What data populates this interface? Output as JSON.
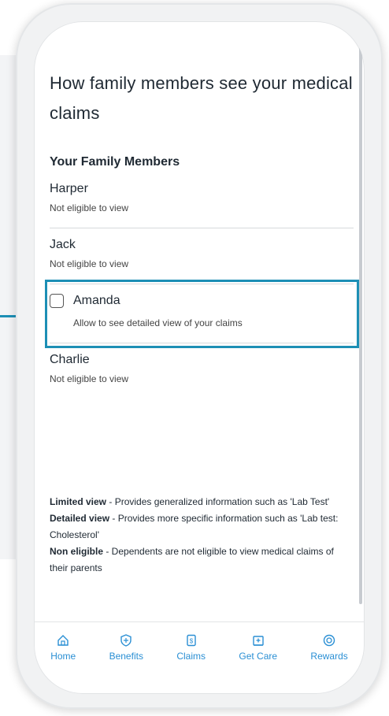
{
  "header": {
    "title": "How family members see your medical claims"
  },
  "section": {
    "title": "Your Family Members"
  },
  "members": [
    {
      "name": "Harper",
      "status": "Not eligible to view"
    },
    {
      "name": "Jack",
      "status": "Not eligible to view"
    },
    {
      "name": "Amanda",
      "status": "Allow to see detailed view of your claims",
      "checked": false
    },
    {
      "name": "Charlie",
      "status": "Not eligible to view"
    }
  ],
  "legend": {
    "limited_term": "Limited view",
    "limited_desc": " - Provides generalized information such as 'Lab Test'",
    "detailed_term": "Detailed view",
    "detailed_desc": " - Provides more specific information such as 'Lab test: Cholesterol'",
    "noneligible_term": "Non eligible",
    "noneligible_desc": " - Dependents are not eligible to view medical claims of their parents"
  },
  "tabs": [
    {
      "label": "Home",
      "icon": "home-icon"
    },
    {
      "label": "Benefits",
      "icon": "shield-icon"
    },
    {
      "label": "Claims",
      "icon": "document-dollar-icon"
    },
    {
      "label": "Get Care",
      "icon": "hospital-icon"
    },
    {
      "label": "Rewards",
      "icon": "target-icon"
    }
  ],
  "colors": {
    "accent": "#2a8fd4",
    "highlight": "#1d8fb5"
  }
}
